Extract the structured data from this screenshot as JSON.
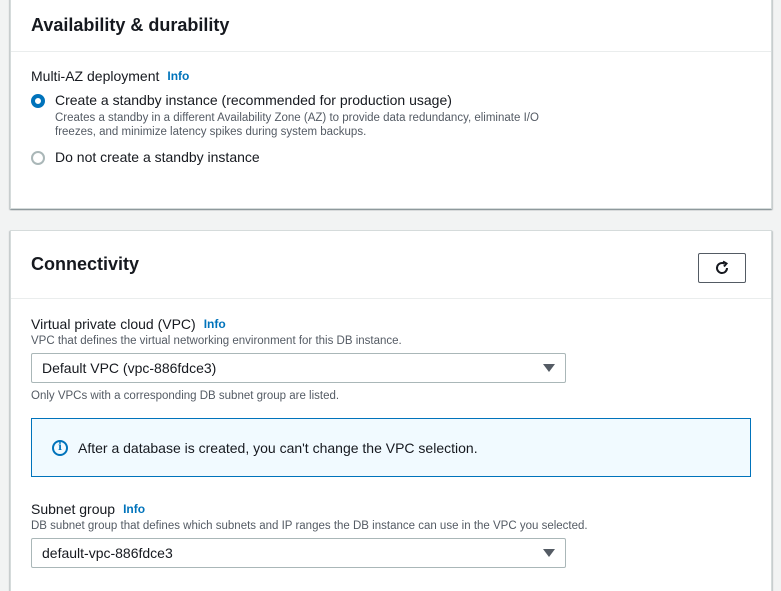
{
  "availability": {
    "title": "Availability & durability",
    "multi_az_label": "Multi-AZ deployment",
    "info": "Info",
    "options": [
      {
        "label": "Create a standby instance (recommended for production usage)",
        "desc": "Creates a standby in a different Availability Zone (AZ) to provide data redundancy, eliminate I/O freezes, and minimize latency spikes during system backups.",
        "selected": true
      },
      {
        "label": "Do not create a standby instance",
        "desc": "",
        "selected": false
      }
    ]
  },
  "connectivity": {
    "title": "Connectivity",
    "refresh_icon": "refresh-icon",
    "vpc": {
      "label": "Virtual private cloud (VPC)",
      "info": "Info",
      "desc": "VPC that defines the virtual networking environment for this DB instance.",
      "value": "Default VPC (vpc-886fdce3)",
      "hint": "Only VPCs with a corresponding DB subnet group are listed."
    },
    "alert": {
      "icon": "info-circle-icon",
      "text": "After a database is created, you can't change the VPC selection."
    },
    "subnet": {
      "label": "Subnet group",
      "info": "Info",
      "desc": "DB subnet group that defines which subnets and IP ranges the DB instance can use in the VPC you selected.",
      "value": "default-vpc-886fdce3"
    }
  },
  "colors": {
    "accent": "#0073bb",
    "border": "#aab7b8",
    "text": "#16191f",
    "muted": "#545b64"
  }
}
